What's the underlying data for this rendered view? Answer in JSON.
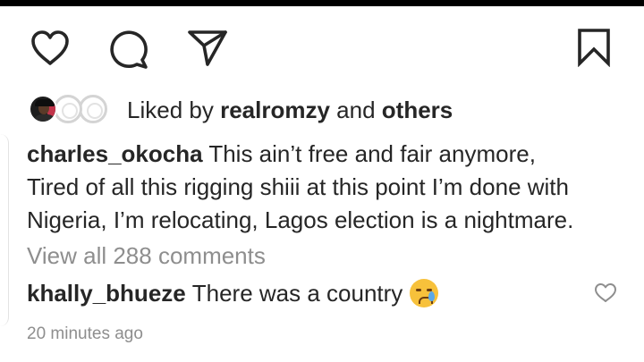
{
  "actions": {
    "like_icon": "heart-icon",
    "comment_icon": "comment-bubble-icon",
    "share_icon": "paper-plane-icon",
    "save_icon": "bookmark-icon"
  },
  "likes": {
    "prefix": "Liked by",
    "user": "realromzy",
    "connector": "and",
    "suffix": "others"
  },
  "caption": {
    "username": "charles_okocha",
    "text_line1": "This ain’t free and fair anymore,",
    "text_line2": "Tired of all this rigging shiii at this point I’m done with",
    "text_line3": "Nigeria, I’m relocating, Lagos election is a nightmare."
  },
  "view_all_comments": "View all 288 comments",
  "comment": {
    "username": "khally_bhueze",
    "text": "There was a country",
    "emoji_icon": "crying-face-emoji"
  },
  "timestamp": "20 minutes ago",
  "colors": {
    "text": "#262626",
    "secondary_text": "#8e8e8e",
    "background": "#ffffff"
  }
}
